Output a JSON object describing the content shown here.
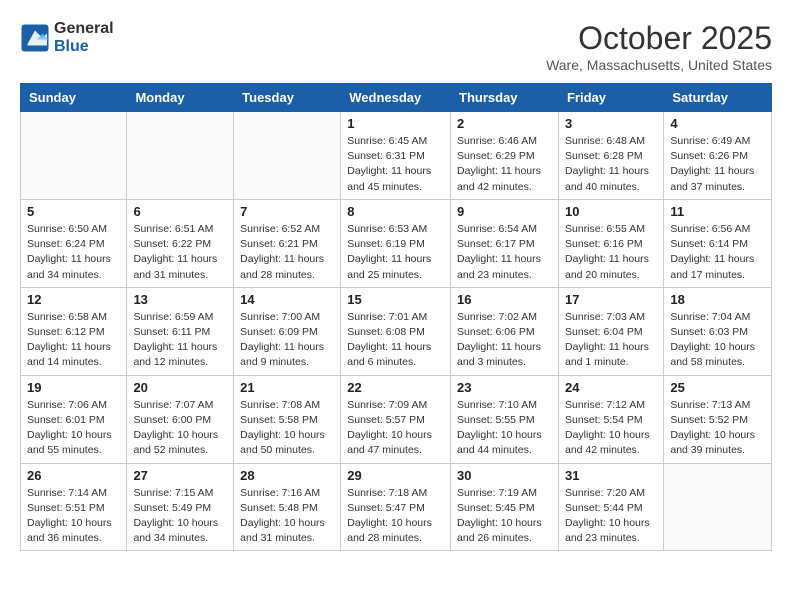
{
  "header": {
    "logo_general": "General",
    "logo_blue": "Blue",
    "title": "October 2025",
    "subtitle": "Ware, Massachusetts, United States"
  },
  "weekdays": [
    "Sunday",
    "Monday",
    "Tuesday",
    "Wednesday",
    "Thursday",
    "Friday",
    "Saturday"
  ],
  "weeks": [
    [
      {
        "day": "",
        "info": ""
      },
      {
        "day": "",
        "info": ""
      },
      {
        "day": "",
        "info": ""
      },
      {
        "day": "1",
        "info": "Sunrise: 6:45 AM\nSunset: 6:31 PM\nDaylight: 11 hours\nand 45 minutes."
      },
      {
        "day": "2",
        "info": "Sunrise: 6:46 AM\nSunset: 6:29 PM\nDaylight: 11 hours\nand 42 minutes."
      },
      {
        "day": "3",
        "info": "Sunrise: 6:48 AM\nSunset: 6:28 PM\nDaylight: 11 hours\nand 40 minutes."
      },
      {
        "day": "4",
        "info": "Sunrise: 6:49 AM\nSunset: 6:26 PM\nDaylight: 11 hours\nand 37 minutes."
      }
    ],
    [
      {
        "day": "5",
        "info": "Sunrise: 6:50 AM\nSunset: 6:24 PM\nDaylight: 11 hours\nand 34 minutes."
      },
      {
        "day": "6",
        "info": "Sunrise: 6:51 AM\nSunset: 6:22 PM\nDaylight: 11 hours\nand 31 minutes."
      },
      {
        "day": "7",
        "info": "Sunrise: 6:52 AM\nSunset: 6:21 PM\nDaylight: 11 hours\nand 28 minutes."
      },
      {
        "day": "8",
        "info": "Sunrise: 6:53 AM\nSunset: 6:19 PM\nDaylight: 11 hours\nand 25 minutes."
      },
      {
        "day": "9",
        "info": "Sunrise: 6:54 AM\nSunset: 6:17 PM\nDaylight: 11 hours\nand 23 minutes."
      },
      {
        "day": "10",
        "info": "Sunrise: 6:55 AM\nSunset: 6:16 PM\nDaylight: 11 hours\nand 20 minutes."
      },
      {
        "day": "11",
        "info": "Sunrise: 6:56 AM\nSunset: 6:14 PM\nDaylight: 11 hours\nand 17 minutes."
      }
    ],
    [
      {
        "day": "12",
        "info": "Sunrise: 6:58 AM\nSunset: 6:12 PM\nDaylight: 11 hours\nand 14 minutes."
      },
      {
        "day": "13",
        "info": "Sunrise: 6:59 AM\nSunset: 6:11 PM\nDaylight: 11 hours\nand 12 minutes."
      },
      {
        "day": "14",
        "info": "Sunrise: 7:00 AM\nSunset: 6:09 PM\nDaylight: 11 hours\nand 9 minutes."
      },
      {
        "day": "15",
        "info": "Sunrise: 7:01 AM\nSunset: 6:08 PM\nDaylight: 11 hours\nand 6 minutes."
      },
      {
        "day": "16",
        "info": "Sunrise: 7:02 AM\nSunset: 6:06 PM\nDaylight: 11 hours\nand 3 minutes."
      },
      {
        "day": "17",
        "info": "Sunrise: 7:03 AM\nSunset: 6:04 PM\nDaylight: 11 hours\nand 1 minute."
      },
      {
        "day": "18",
        "info": "Sunrise: 7:04 AM\nSunset: 6:03 PM\nDaylight: 10 hours\nand 58 minutes."
      }
    ],
    [
      {
        "day": "19",
        "info": "Sunrise: 7:06 AM\nSunset: 6:01 PM\nDaylight: 10 hours\nand 55 minutes."
      },
      {
        "day": "20",
        "info": "Sunrise: 7:07 AM\nSunset: 6:00 PM\nDaylight: 10 hours\nand 52 minutes."
      },
      {
        "day": "21",
        "info": "Sunrise: 7:08 AM\nSunset: 5:58 PM\nDaylight: 10 hours\nand 50 minutes."
      },
      {
        "day": "22",
        "info": "Sunrise: 7:09 AM\nSunset: 5:57 PM\nDaylight: 10 hours\nand 47 minutes."
      },
      {
        "day": "23",
        "info": "Sunrise: 7:10 AM\nSunset: 5:55 PM\nDaylight: 10 hours\nand 44 minutes."
      },
      {
        "day": "24",
        "info": "Sunrise: 7:12 AM\nSunset: 5:54 PM\nDaylight: 10 hours\nand 42 minutes."
      },
      {
        "day": "25",
        "info": "Sunrise: 7:13 AM\nSunset: 5:52 PM\nDaylight: 10 hours\nand 39 minutes."
      }
    ],
    [
      {
        "day": "26",
        "info": "Sunrise: 7:14 AM\nSunset: 5:51 PM\nDaylight: 10 hours\nand 36 minutes."
      },
      {
        "day": "27",
        "info": "Sunrise: 7:15 AM\nSunset: 5:49 PM\nDaylight: 10 hours\nand 34 minutes."
      },
      {
        "day": "28",
        "info": "Sunrise: 7:16 AM\nSunset: 5:48 PM\nDaylight: 10 hours\nand 31 minutes."
      },
      {
        "day": "29",
        "info": "Sunrise: 7:18 AM\nSunset: 5:47 PM\nDaylight: 10 hours\nand 28 minutes."
      },
      {
        "day": "30",
        "info": "Sunrise: 7:19 AM\nSunset: 5:45 PM\nDaylight: 10 hours\nand 26 minutes."
      },
      {
        "day": "31",
        "info": "Sunrise: 7:20 AM\nSunset: 5:44 PM\nDaylight: 10 hours\nand 23 minutes."
      },
      {
        "day": "",
        "info": ""
      }
    ]
  ]
}
